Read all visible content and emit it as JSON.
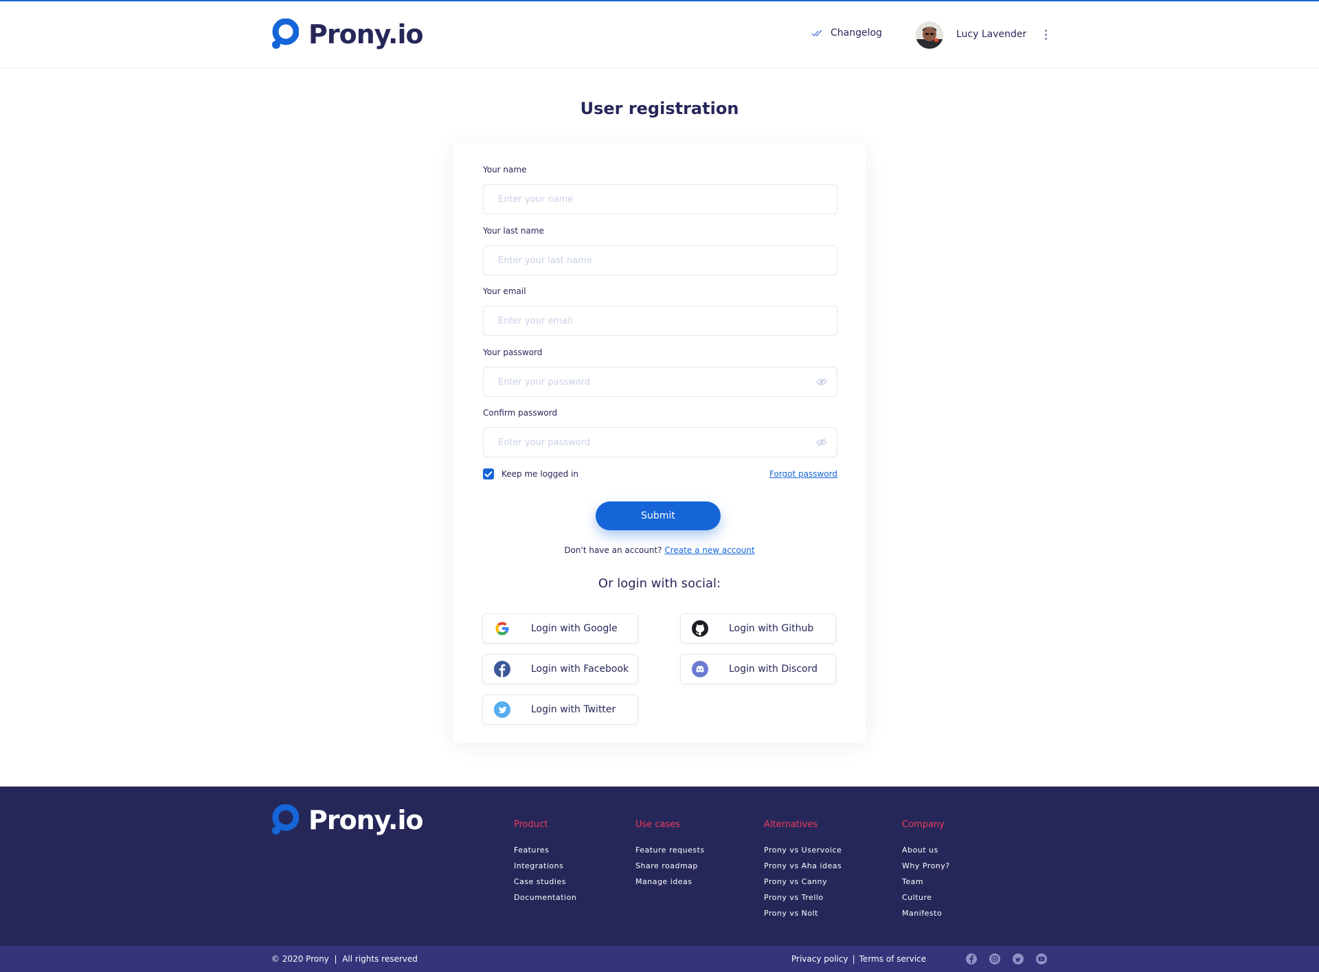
{
  "header": {
    "brand": "Prony.io",
    "changelog_label": "Changelog",
    "user_name": "Lucy Lavender"
  },
  "page": {
    "title": "User registration"
  },
  "form": {
    "fields": [
      {
        "label": "Your name",
        "placeholder": "Enter your name"
      },
      {
        "label": "Your last name",
        "placeholder": "Enter your last name"
      },
      {
        "label": "Your email",
        "placeholder": "Enter your email"
      },
      {
        "label": "Your password",
        "placeholder": "Enter your password"
      },
      {
        "label": "Confirm password",
        "placeholder": "Enter your password"
      }
    ],
    "keep_logged_in_label": "Keep me logged in",
    "keep_logged_in_checked": true,
    "forgot_password": "Forgot password",
    "submit_label": "Submit",
    "no_account_text": "Don't have an account?",
    "create_account_link": "Create a new account",
    "social_title": "Or login with social:",
    "social": {
      "google": "Login with Google",
      "github": "Login with Github",
      "facebook": "Login with Facebook",
      "discord": "Login with Discord",
      "twitter": "Login with Twitter"
    }
  },
  "footer": {
    "brand": "Prony.io",
    "columns": [
      {
        "heading": "Product",
        "links": [
          "Features",
          "Integrations",
          "Case studies",
          "Documentation"
        ]
      },
      {
        "heading": "Use cases",
        "links": [
          "Feature requests",
          "Share roadmap",
          "Manage ideas"
        ]
      },
      {
        "heading": "Alternatives",
        "links": [
          "Prony vs Uservoice",
          "Prony vs Aha ideas",
          "Prony vs Canny",
          "Prony vs Trello",
          "Prony vs Nolt"
        ]
      },
      {
        "heading": "Company",
        "links": [
          "About us",
          "Why Prony?",
          "Team",
          "Culture",
          "Manifesto"
        ]
      }
    ],
    "copyright": "© 2020 Prony  |  All rights reserved",
    "privacy": "Privacy policy",
    "separator": "|",
    "terms": "Terms of service",
    "social_icons": [
      "facebook-icon",
      "instagram-icon",
      "twitter-icon",
      "youtube-icon"
    ]
  },
  "colors": {
    "accent": "#1565d8",
    "navy": "#262759",
    "footer_heading": "#ef3a5d",
    "bottombar": "#33347a"
  }
}
